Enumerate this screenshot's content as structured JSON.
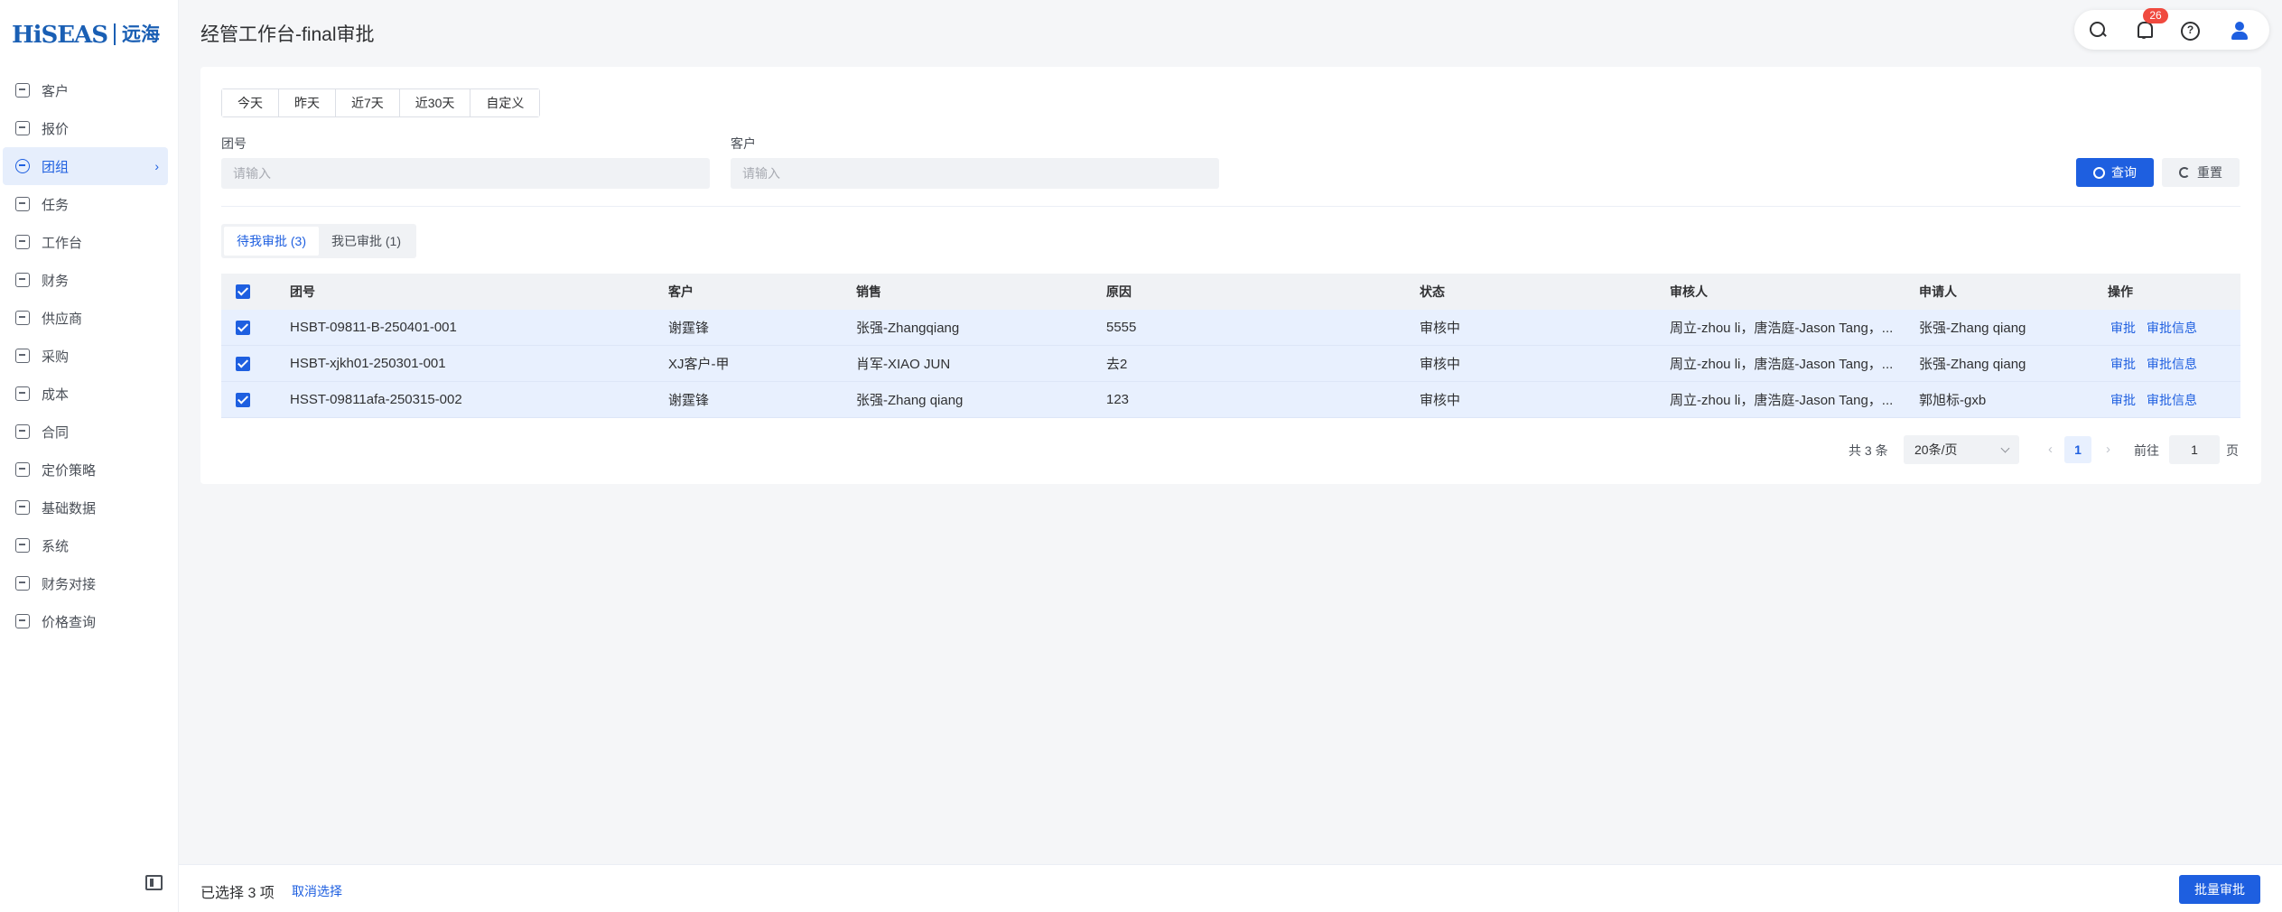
{
  "logo": {
    "brand": "HiSEAS",
    "cn": "远海"
  },
  "sidebar": {
    "items": [
      {
        "label": "客户",
        "icon": "customer-icon"
      },
      {
        "label": "报价",
        "icon": "quote-icon"
      },
      {
        "label": "团组",
        "icon": "group-icon",
        "active": true
      },
      {
        "label": "任务",
        "icon": "task-icon"
      },
      {
        "label": "工作台",
        "icon": "workbench-icon"
      },
      {
        "label": "财务",
        "icon": "finance-icon"
      },
      {
        "label": "供应商",
        "icon": "supplier-icon"
      },
      {
        "label": "采购",
        "icon": "purchase-icon"
      },
      {
        "label": "成本",
        "icon": "cost-icon"
      },
      {
        "label": "合同",
        "icon": "contract-icon"
      },
      {
        "label": "定价策略",
        "icon": "pricing-icon"
      },
      {
        "label": "基础数据",
        "icon": "basedata-icon"
      },
      {
        "label": "系统",
        "icon": "system-icon"
      },
      {
        "label": "财务对接",
        "icon": "finance-link-icon"
      },
      {
        "label": "价格查询",
        "icon": "price-search-icon"
      }
    ]
  },
  "header": {
    "title": "经管工作台-final审批",
    "notification_count": "26"
  },
  "filters": {
    "date_ranges": [
      "今天",
      "昨天",
      "近7天",
      "近30天",
      "自定义"
    ],
    "team_label": "团号",
    "team_placeholder": "请输入",
    "customer_label": "客户",
    "customer_placeholder": "请输入",
    "query_label": "查询",
    "reset_label": "重置"
  },
  "tabs": {
    "pending": "待我审批 (3)",
    "done": "我已审批 (1)"
  },
  "table": {
    "headers": {
      "team": "团号",
      "customer": "客户",
      "sales": "销售",
      "reason": "原因",
      "status": "状态",
      "auditor": "审核人",
      "applicant": "申请人",
      "ops": "操作"
    },
    "rows": [
      {
        "team": "HSBT-09811-B-250401-001",
        "customer": "谢霆锋",
        "sales": "张强-Zhangqiang",
        "reason": "5555",
        "status": "审核中",
        "auditor": "周立-zhou li，唐浩庭-Jason Tang，...",
        "applicant": "张强-Zhang qiang",
        "op1": "审批",
        "op2": "审批信息"
      },
      {
        "team": "HSBT-xjkh01-250301-001",
        "customer": "XJ客户-甲",
        "sales": "肖军-XIAO JUN",
        "reason": "去2",
        "status": "审核中",
        "auditor": "周立-zhou li，唐浩庭-Jason Tang，...",
        "applicant": "张强-Zhang qiang",
        "op1": "审批",
        "op2": "审批信息"
      },
      {
        "team": "HSST-09811afa-250315-002",
        "customer": "谢霆锋",
        "sales": "张强-Zhang qiang",
        "reason": "123",
        "status": "审核中",
        "auditor": "周立-zhou li，唐浩庭-Jason Tang，...",
        "applicant": "郭旭标-gxb",
        "op1": "审批",
        "op2": "审批信息"
      }
    ]
  },
  "pager": {
    "total": "共 3 条",
    "page_size": "20条/页",
    "current": "1",
    "goto_label": "前往",
    "goto_value": "1",
    "unit": "页"
  },
  "footer": {
    "selected": "已选择 3 项",
    "cancel": "取消选择",
    "batch": "批量审批"
  },
  "colors": {
    "primary": "#1e5fe0",
    "badge": "#f04a3f",
    "row_selected": "#e8f0fe"
  }
}
